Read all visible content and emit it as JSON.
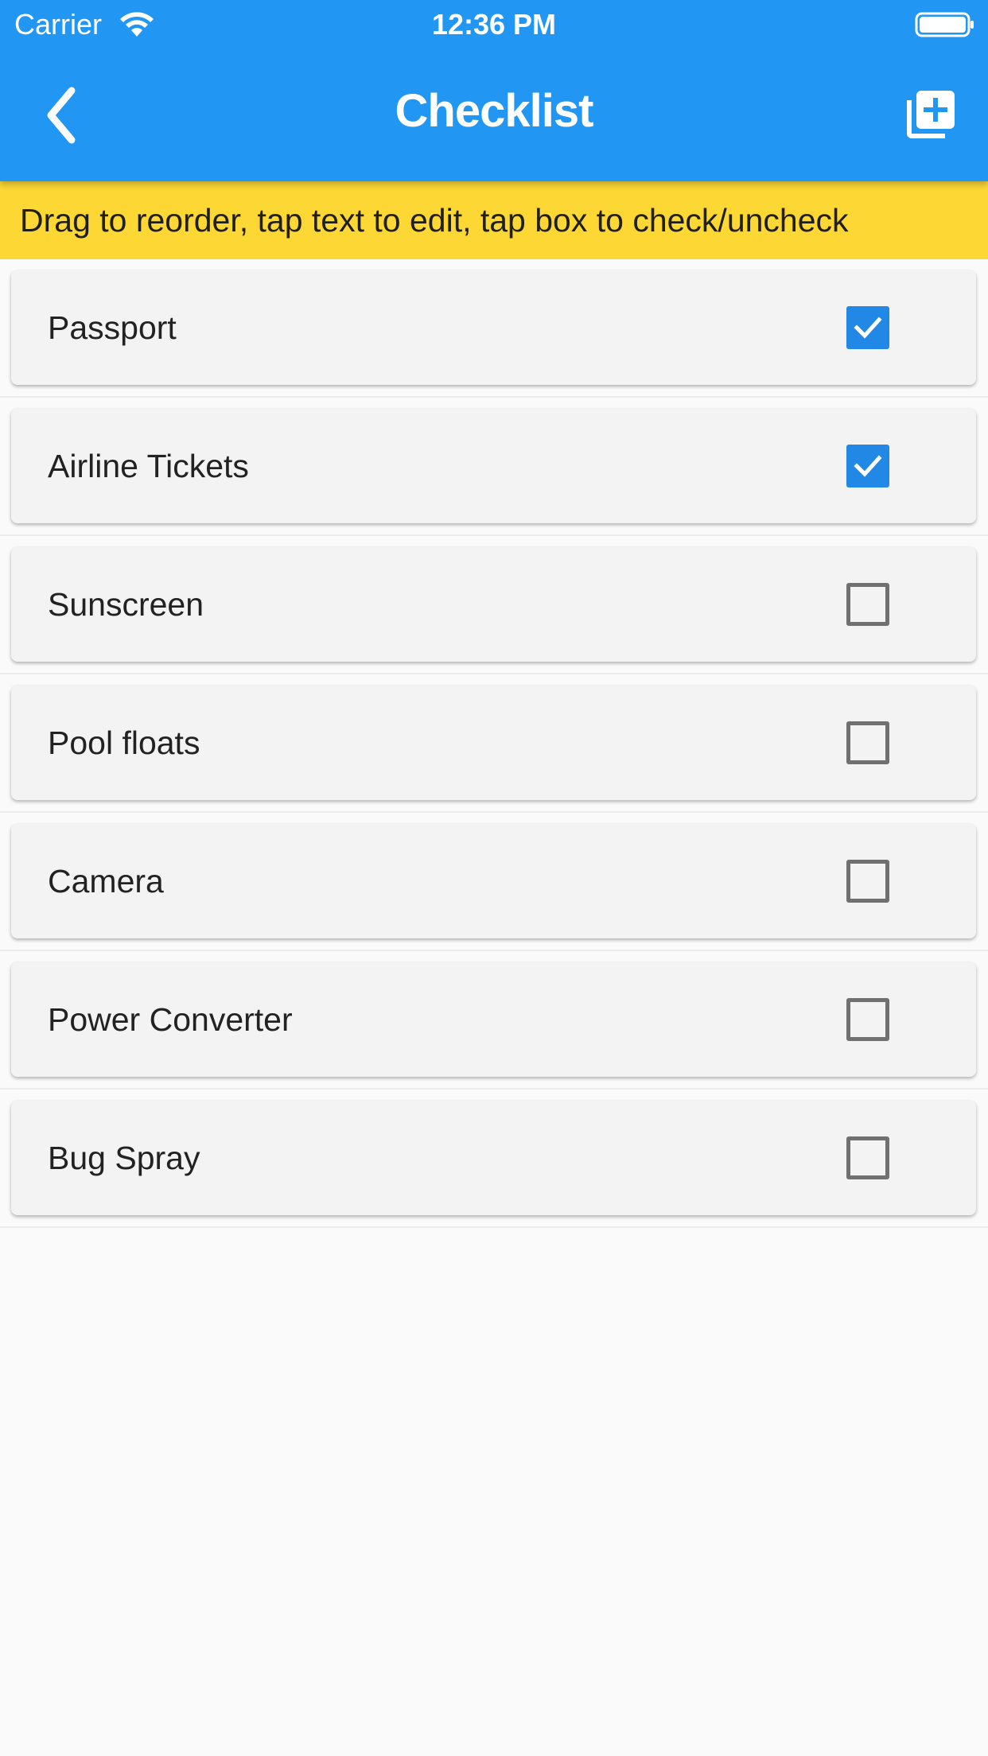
{
  "status_bar": {
    "carrier": "Carrier",
    "time": "12:36 PM"
  },
  "app_bar": {
    "title": "Checklist",
    "back_icon": "chevron-left-icon",
    "add_icon": "library-add-icon"
  },
  "hint": "Drag to reorder, tap text to edit, tap box to check/uncheck",
  "colors": {
    "primary": "#2196f3",
    "hint_background": "#fdd835",
    "checkbox_checked": "#2188e6"
  },
  "items": [
    {
      "label": "Passport",
      "checked": true
    },
    {
      "label": "Airline Tickets",
      "checked": true
    },
    {
      "label": "Sunscreen",
      "checked": false
    },
    {
      "label": "Pool floats",
      "checked": false
    },
    {
      "label": "Camera",
      "checked": false
    },
    {
      "label": "Power Converter",
      "checked": false
    },
    {
      "label": "Bug Spray",
      "checked": false
    }
  ]
}
